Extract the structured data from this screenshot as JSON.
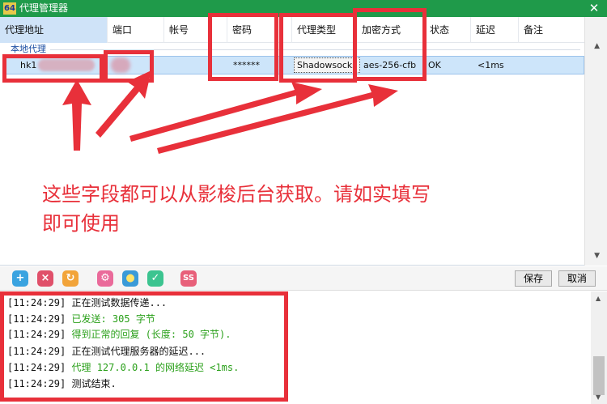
{
  "window": {
    "title": "代理管理器",
    "app_icon_text": "64",
    "close_symbol": "✕"
  },
  "columns": [
    "代理地址",
    "端口",
    "帐号",
    "密码",
    "代理类型",
    "加密方式",
    "状态",
    "延迟",
    "备注"
  ],
  "group": {
    "label": "本地代理"
  },
  "row": {
    "address_visible": "hk1",
    "password": "******",
    "type": "Shadowsocks",
    "encryption": "aes-256-cfb",
    "status": "OK",
    "latency": "<1ms"
  },
  "toolbar": {
    "save_label": "保存",
    "cancel_label": "取消",
    "icons": [
      "add-icon",
      "delete-icon",
      "refresh-icon",
      "settings-icon",
      "bulb-icon",
      "check-icon",
      "ss-icon"
    ]
  },
  "log": [
    {
      "time": "[11:24:29]",
      "msg": "正在测试数据传递...",
      "color": "black"
    },
    {
      "time": "[11:24:29]",
      "msg": "已发送: 305 字节",
      "color": "green"
    },
    {
      "time": "[11:24:29]",
      "msg": "得到正常的回复 (长度: 50 字节).",
      "color": "green"
    },
    {
      "time": "[11:24:29]",
      "msg": "正在测试代理服务器的延迟...",
      "color": "black"
    },
    {
      "time": "[11:24:29]",
      "msg": "代理 127.0.0.1 的网络延迟 <1ms.",
      "color": "green"
    },
    {
      "time": "[11:24:29]",
      "msg": "测试结束.",
      "color": "black"
    }
  ],
  "annotation": {
    "line1": "这些字段都可以从影梭后台获取。请如实填写",
    "line2": "即可使用"
  },
  "colors": {
    "titlebar": "#1f9a4a",
    "highlight": "#e8303a",
    "selected_row": "#cde5fa",
    "log_green": "#2aa01a"
  }
}
